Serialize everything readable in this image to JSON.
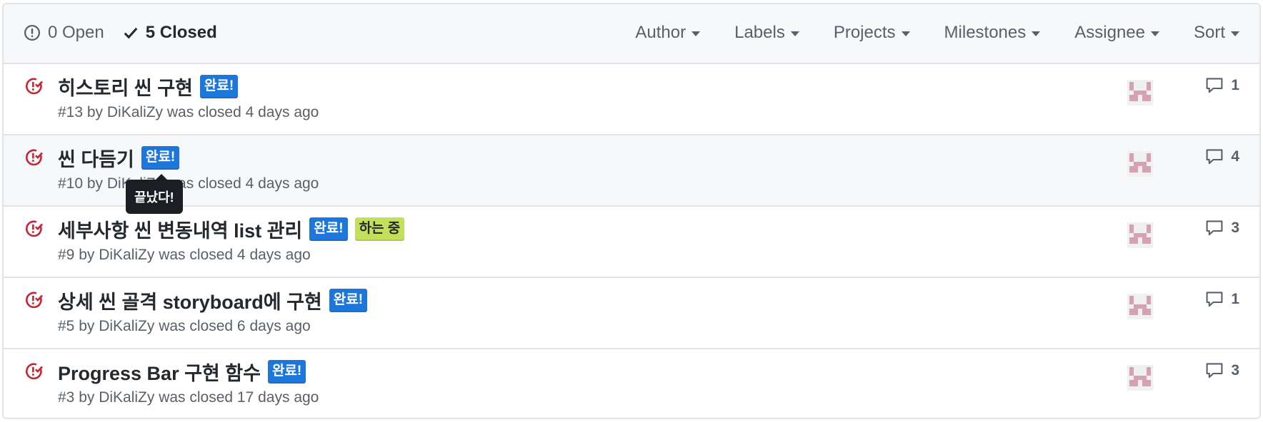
{
  "header": {
    "open": {
      "icon": "issue-opened-icon",
      "label": "0 Open"
    },
    "closed": {
      "icon": "check-icon",
      "label": "5 Closed"
    },
    "filters": [
      "Author",
      "Labels",
      "Projects",
      "Milestones",
      "Assignee",
      "Sort"
    ]
  },
  "colors": {
    "closed_icon": "#cb2431",
    "label_done_bg": "#1d76db",
    "label_done_fg": "#ffffff",
    "label_doing_bg": "#c2e05a",
    "label_doing_fg": "#24292e",
    "avatar": "#d6a1b3"
  },
  "issues": [
    {
      "title": "히스토리 씬 구현",
      "labels": [
        "완료!"
      ],
      "meta": "#13 by DiKaliZy was closed 4 days ago",
      "comments": "1"
    },
    {
      "title": "씬 다듬기",
      "labels": [
        "완료!"
      ],
      "meta": "#10 by DiKaliZy was closed 4 days ago",
      "comments": "4"
    },
    {
      "title": "세부사항 씬 변동내역 list 관리",
      "labels": [
        "완료!",
        "하는 중"
      ],
      "meta": "#9 by DiKaliZy was closed 4 days ago",
      "comments": "3"
    },
    {
      "title": "상세 씬 골격 storyboard에 구현",
      "labels": [
        "완료!"
      ],
      "meta": "#5 by DiKaliZy was closed 6 days ago",
      "comments": "1"
    },
    {
      "title": "Progress Bar 구현 함수",
      "labels": [
        "완료!"
      ],
      "meta": "#3 by DiKaliZy was closed 17 days ago",
      "comments": "3"
    }
  ],
  "tooltip": {
    "text": "끝났다!"
  }
}
